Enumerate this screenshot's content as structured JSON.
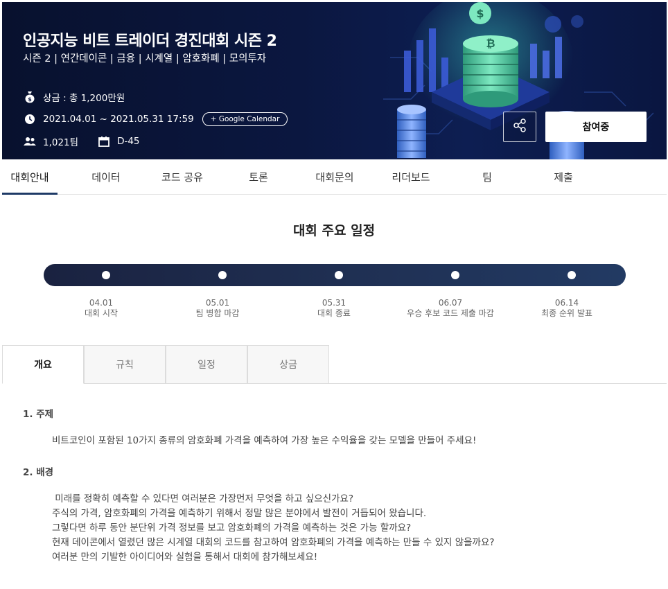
{
  "banner": {
    "title": "인공지능 비트 트레이더 경진대회 시즌 2",
    "subtitle": "시즌 2 | 연간데이콘 | 금융 | 시계열 | 암호화폐 | 모의투자",
    "prize": "상금 : 총 1,200만원",
    "period": "2021.04.01 ~ 2021.05.31 17:59",
    "google_calendar": "+ Google Calendar",
    "teams": "1,021팀",
    "dday": "D-45",
    "join_label": "참여중",
    "icons": {
      "prize": "money-bag-icon",
      "period": "clock-icon",
      "teams": "people-icon",
      "dday": "calendar-icon",
      "share": "share-icon"
    }
  },
  "main_tabs": [
    {
      "label": "대회안내"
    },
    {
      "label": "데이터"
    },
    {
      "label": "코드 공유"
    },
    {
      "label": "토론"
    },
    {
      "label": "대회문의"
    },
    {
      "label": "리더보드"
    },
    {
      "label": "팀"
    },
    {
      "label": "제출"
    }
  ],
  "active_main_tab": "대회안내",
  "schedule": {
    "title": "대회 주요 일정",
    "events": [
      {
        "date": "04.01",
        "label": "대회 시작"
      },
      {
        "date": "05.01",
        "label": "팀 병합 마감"
      },
      {
        "date": "05.31",
        "label": "대회 종료"
      },
      {
        "date": "06.07",
        "label": "우승 후보 코드 제출 마감"
      },
      {
        "date": "06.14",
        "label": "최종 순위 발표"
      }
    ]
  },
  "sub_tabs": [
    {
      "label": "개요"
    },
    {
      "label": "규칙"
    },
    {
      "label": "일정"
    },
    {
      "label": "상금"
    }
  ],
  "active_sub_tab": "개요",
  "content": {
    "section1_title": "1. 주제",
    "section1_text": "비트코인이 포함된 10가지 종류의 암호화폐 가격을 예측하여 가장 높은 수익율을 갖는 모델을 만들어 주세요!",
    "section2_title": "2. 배경",
    "section2_lines": [
      " 미래를 정확히 예측할 수 있다면 여러분은 가장먼저 무엇을 하고 싶으신가요?",
      "주식의 가격, 암호화폐의 가격을 예측하기 위해서 정말 많은 분야에서 발전이 거듭되어 왔습니다.",
      "그렇다면 하루 동안 분단위 가격 정보를 보고 암호화폐의 가격을 예측하는 것은 가능 할까요?",
      "현재 데이콘에서 열렸던 많은 시계열 대회의 코드를 참고하여 암호화폐의 가격을 예측하는 만들 수 있지 않을까요?",
      "여러분 만의 기발한 아이디어와 실험을 통해서 대회에 참가해보세요!"
    ]
  },
  "colors": {
    "banner_bg": "#0b1740",
    "timeline": "#1f2f52",
    "tab_underline": "#1e3a66",
    "coin_green": "#5fd0a0"
  }
}
